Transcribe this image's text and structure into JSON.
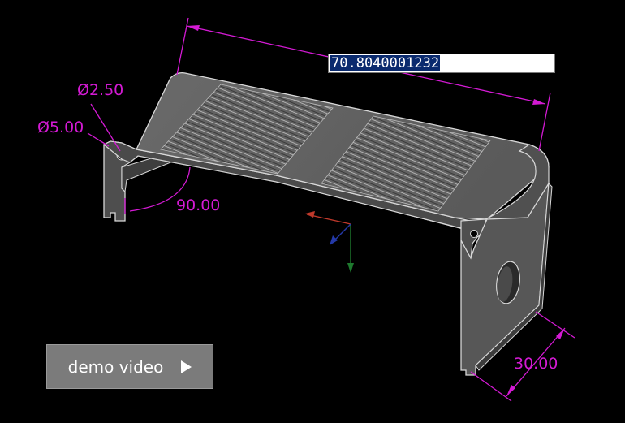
{
  "dimension_input": {
    "value": "70.8040001232"
  },
  "dimensions": {
    "diameter_small": "Ø2.50",
    "diameter_large": "Ø5.00",
    "angle": "90.00",
    "width": "30.00"
  },
  "demo_button": {
    "label": "demo video",
    "icon": "play-icon"
  },
  "colors": {
    "background": "#000000",
    "dimension": "#d41ad4",
    "solid_fill": "#555555",
    "edge": "#d8d8d8",
    "axis_x": "#c0392b",
    "axis_y": "#1e7a2e",
    "axis_z": "#2439a8",
    "button_bg": "#7b7b7b"
  }
}
